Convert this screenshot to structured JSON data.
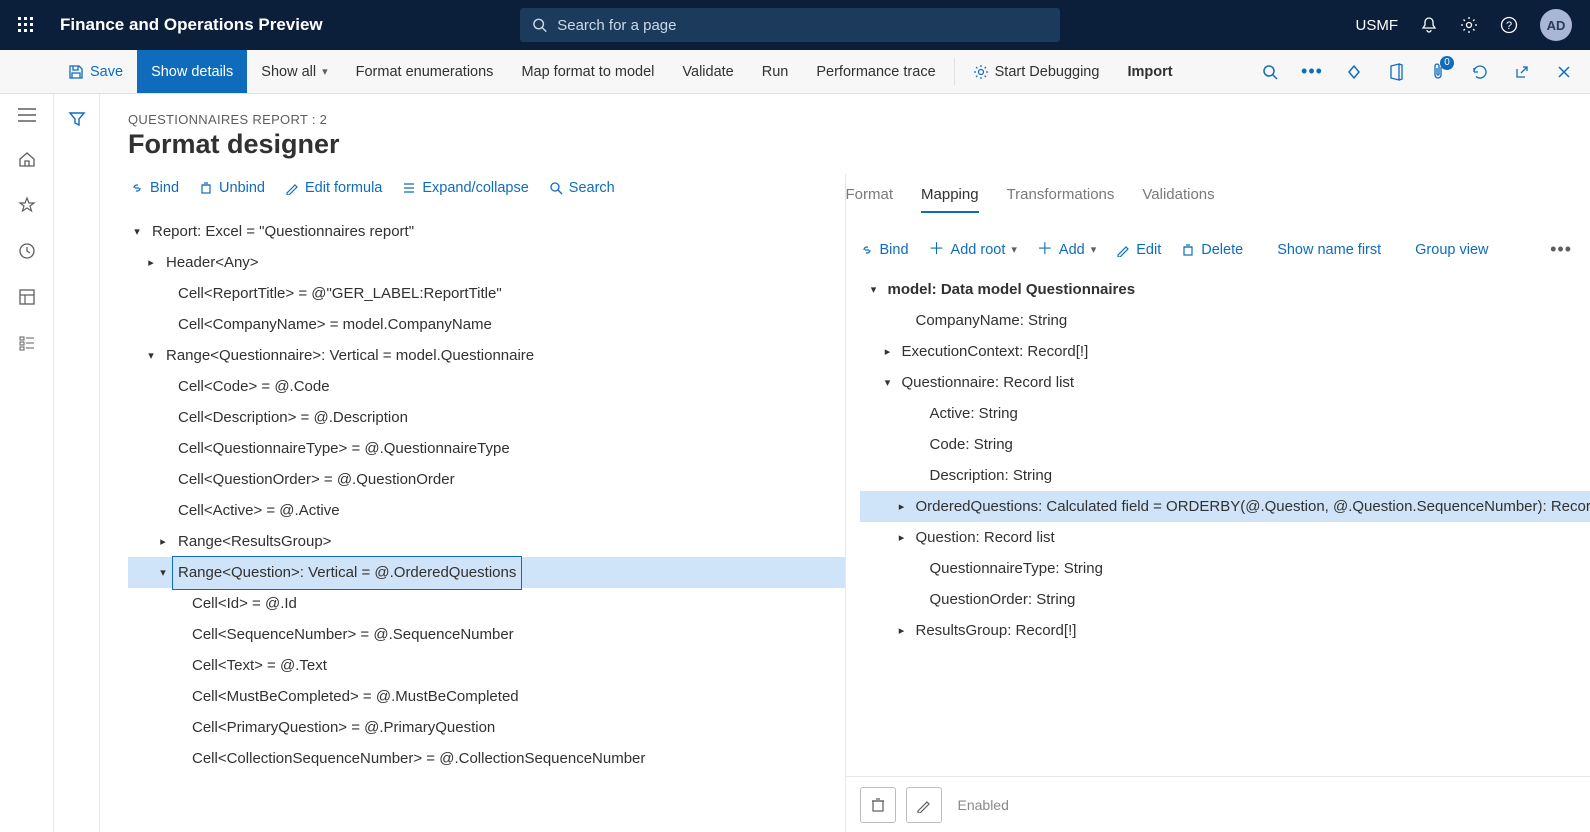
{
  "header": {
    "app_title": "Finance and Operations Preview",
    "search_placeholder": "Search for a page",
    "company": "USMF",
    "avatar": "AD"
  },
  "toolbar": {
    "save": "Save",
    "show_details": "Show details",
    "show_all": "Show all",
    "format_enum": "Format enumerations",
    "map_format": "Map format to model",
    "validate": "Validate",
    "run": "Run",
    "perf_trace": "Performance trace",
    "start_debugging": "Start Debugging",
    "import": "Import",
    "attach_badge": "0"
  },
  "page": {
    "breadcrumb": "QUESTIONNAIRES REPORT : 2",
    "title": "Format designer"
  },
  "left_toolbar": {
    "bind": "Bind",
    "unbind": "Unbind",
    "edit_formula": "Edit formula",
    "expand_collapse": "Expand/collapse",
    "search": "Search"
  },
  "left_tree": [
    {
      "ind": 0,
      "toggle": "down",
      "label": "Report: Excel = \"Questionnaires report\""
    },
    {
      "ind": 1,
      "toggle": "right",
      "label": "Header<Any>"
    },
    {
      "ind": 2,
      "toggle": "",
      "label": "Cell<ReportTitle> = @\"GER_LABEL:ReportTitle\""
    },
    {
      "ind": 2,
      "toggle": "",
      "label": "Cell<CompanyName> = model.CompanyName"
    },
    {
      "ind": 1,
      "toggle": "down",
      "label": "Range<Questionnaire>: Vertical = model.Questionnaire"
    },
    {
      "ind": 2,
      "toggle": "",
      "label": "Cell<Code> = @.Code"
    },
    {
      "ind": 2,
      "toggle": "",
      "label": "Cell<Description> = @.Description"
    },
    {
      "ind": 2,
      "toggle": "",
      "label": "Cell<QuestionnaireType> = @.QuestionnaireType"
    },
    {
      "ind": 2,
      "toggle": "",
      "label": "Cell<QuestionOrder> = @.QuestionOrder"
    },
    {
      "ind": 2,
      "toggle": "",
      "label": "Cell<Active> = @.Active"
    },
    {
      "ind": 2,
      "toggle": "right",
      "label": "Range<ResultsGroup>"
    },
    {
      "ind": 2,
      "toggle": "down",
      "label": "Range<Question>: Vertical = @.OrderedQuestions",
      "selected": true
    },
    {
      "ind": 3,
      "toggle": "",
      "label": "Cell<Id> = @.Id"
    },
    {
      "ind": 3,
      "toggle": "",
      "label": "Cell<SequenceNumber> = @.SequenceNumber"
    },
    {
      "ind": 3,
      "toggle": "",
      "label": "Cell<Text> = @.Text"
    },
    {
      "ind": 3,
      "toggle": "",
      "label": "Cell<MustBeCompleted> = @.MustBeCompleted"
    },
    {
      "ind": 3,
      "toggle": "",
      "label": "Cell<PrimaryQuestion> = @.PrimaryQuestion"
    },
    {
      "ind": 3,
      "toggle": "",
      "label": "Cell<CollectionSequenceNumber> = @.CollectionSequenceNumber"
    }
  ],
  "right_tabs": {
    "format": "Format",
    "mapping": "Mapping",
    "transformations": "Transformations",
    "validations": "Validations"
  },
  "right_toolbar": {
    "bind": "Bind",
    "add_root": "Add root",
    "add": "Add",
    "edit": "Edit",
    "delete": "Delete",
    "show_name_first": "Show name first",
    "group_view": "Group view"
  },
  "right_tree": [
    {
      "ind": 0,
      "toggle": "down",
      "label": "model: Data model Questionnaires",
      "bold": true
    },
    {
      "ind": 2,
      "toggle": "",
      "label": "CompanyName: String"
    },
    {
      "ind": 1,
      "toggle": "right",
      "label": "ExecutionContext: Record[!]"
    },
    {
      "ind": 1,
      "toggle": "down",
      "label": "Questionnaire: Record list"
    },
    {
      "ind": 3,
      "toggle": "",
      "label": "Active: String"
    },
    {
      "ind": 3,
      "toggle": "",
      "label": "Code: String"
    },
    {
      "ind": 3,
      "toggle": "",
      "label": "Description: String"
    },
    {
      "ind": 2,
      "toggle": "right",
      "label": "OrderedQuestions: Calculated field = ORDERBY(@.Question, @.Question.SequenceNumber): Record list",
      "selected": true
    },
    {
      "ind": 2,
      "toggle": "right",
      "label": "Question: Record list"
    },
    {
      "ind": 3,
      "toggle": "",
      "label": "QuestionnaireType: String"
    },
    {
      "ind": 3,
      "toggle": "",
      "label": "QuestionOrder: String"
    },
    {
      "ind": 2,
      "toggle": "right",
      "label": "ResultsGroup: Record[!]"
    }
  ],
  "bottom": {
    "enabled": "Enabled"
  }
}
